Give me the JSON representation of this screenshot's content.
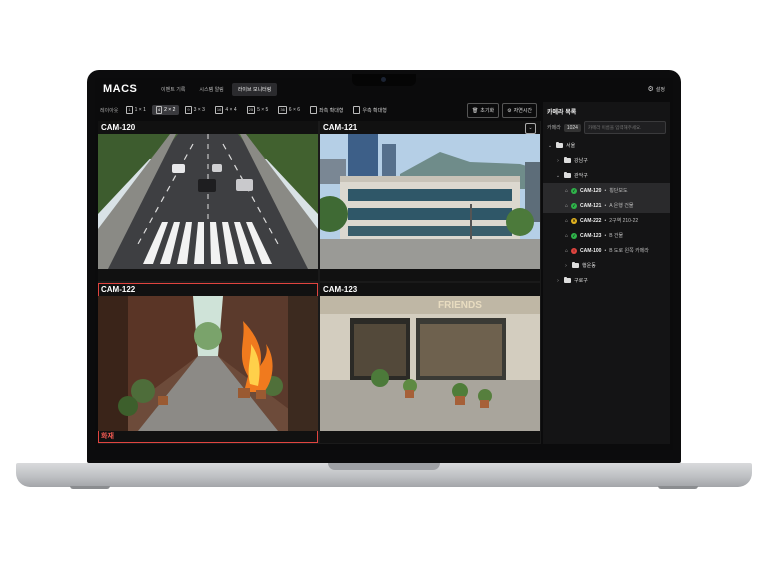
{
  "app": {
    "logo": "MACS",
    "nav_tabs": [
      {
        "label": "이벤트 기록",
        "active": false
      },
      {
        "label": "시스템 알림",
        "active": false
      },
      {
        "label": "라이브 모니터링",
        "active": true
      }
    ],
    "settings_label": "설정"
  },
  "toolbar": {
    "layout_label": "레이아웃",
    "layouts": [
      {
        "num": "1",
        "label": "1 × 1",
        "active": false
      },
      {
        "num": "4",
        "label": "2 × 2",
        "active": true
      },
      {
        "num": "9",
        "label": "3 × 3",
        "active": false
      },
      {
        "num": "16",
        "label": "4 × 4",
        "active": false
      },
      {
        "num": "25",
        "label": "5 × 5",
        "active": false
      },
      {
        "num": "36",
        "label": "6 × 6",
        "active": false
      }
    ],
    "left_expand": "좌측 확대형",
    "right_expand": "우측 확대형",
    "reset_label": "초기화",
    "natural_time_label": "자연시간"
  },
  "grid": {
    "cells": [
      {
        "title": "CAM-120",
        "scene": "road"
      },
      {
        "title": "CAM-121",
        "scene": "building"
      },
      {
        "title": "CAM-122",
        "scene": "alley-fire",
        "alert_label": "화재"
      },
      {
        "title": "CAM-123",
        "scene": "storefront"
      }
    ]
  },
  "panel": {
    "title": "카메라 목록",
    "search_label": "카메라",
    "count": "1024",
    "search_placeholder": "카메라 이름을 입력해주세요.",
    "tree": {
      "root": "서울",
      "districts": [
        {
          "label": "강남구",
          "expanded": false
        },
        {
          "label": "관악구",
          "expanded": true
        },
        {
          "label": "구로구",
          "expanded": false
        }
      ],
      "cameras": [
        {
          "name": "CAM-120",
          "desc": "횡단보도",
          "status": "ok",
          "color": "#2fb34a"
        },
        {
          "name": "CAM-121",
          "desc": "A 은행 건물",
          "status": "ok",
          "color": "#2fb34a"
        },
        {
          "name": "CAM-222",
          "desc": "2구역 210-22",
          "status": "warn",
          "color": "#e3b420"
        },
        {
          "name": "CAM-123",
          "desc": "B 건물",
          "status": "ok",
          "color": "#2fb34a"
        },
        {
          "name": "CAM-100",
          "desc": "B 도로 왼쪽 카메라",
          "status": "error",
          "color": "#e0443f"
        }
      ],
      "subfolder": "행운동"
    }
  }
}
